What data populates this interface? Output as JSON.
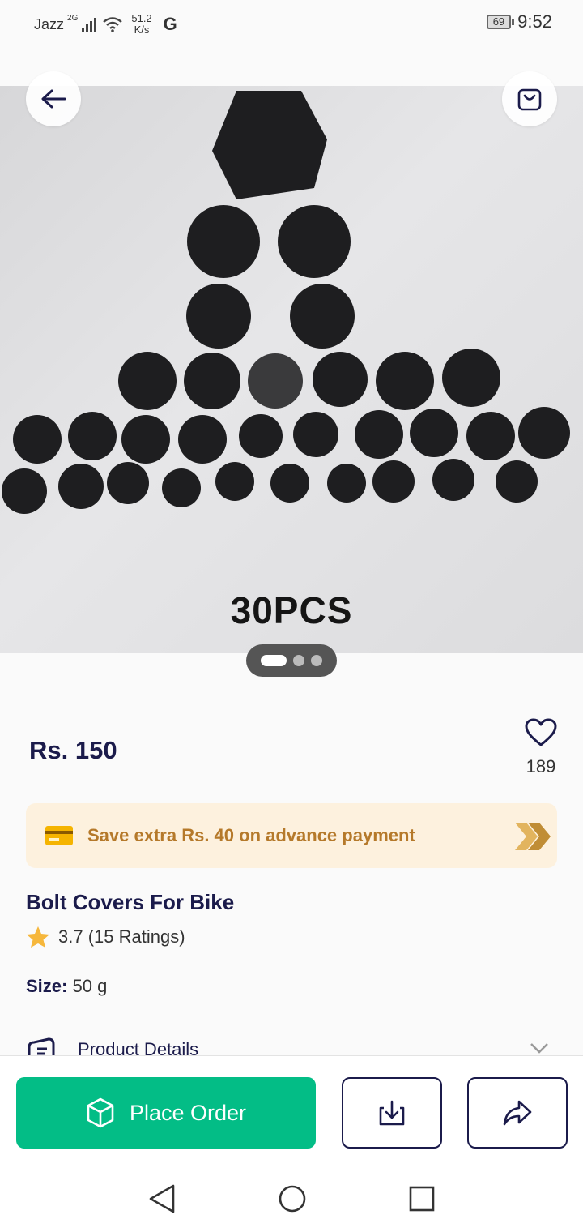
{
  "status_bar": {
    "carrier": "Jazz",
    "network": "2G",
    "speed_value": "51.2",
    "speed_unit": "K/s",
    "g_label": "G",
    "battery": "69",
    "time": "9:52"
  },
  "hero": {
    "caption": "30PCS",
    "image_count": 3,
    "active_index": 0
  },
  "product": {
    "price": "Rs. 150",
    "wishlist_count": "189",
    "promo_text": "Save extra Rs. 40 on advance payment",
    "title": "Bolt Covers For Bike",
    "rating_text": "3.7 (15 Ratings)",
    "size_label": "Size:",
    "size_value": "50 g",
    "details_label": "Product Details"
  },
  "actions": {
    "place_order": "Place Order"
  },
  "colors": {
    "accent": "#03bd86",
    "text_dark": "#1b1b4b",
    "promo_bg": "#fdf1de",
    "promo_text": "#b5792a",
    "star": "#f6b73c"
  },
  "icons": {
    "back": "arrow-left-icon",
    "cart": "shopping-bag-icon",
    "wishlist": "heart-icon",
    "promo": "credit-card-icon",
    "promo_arrows": "double-chevron-right-icon",
    "rating": "star-icon",
    "details": "document-icon",
    "expand": "chevron-down-icon",
    "order": "box-icon",
    "download": "download-icon",
    "share": "share-icon",
    "nav_back": "triangle-back-icon",
    "nav_home": "circle-home-icon",
    "nav_recent": "square-recent-icon"
  }
}
